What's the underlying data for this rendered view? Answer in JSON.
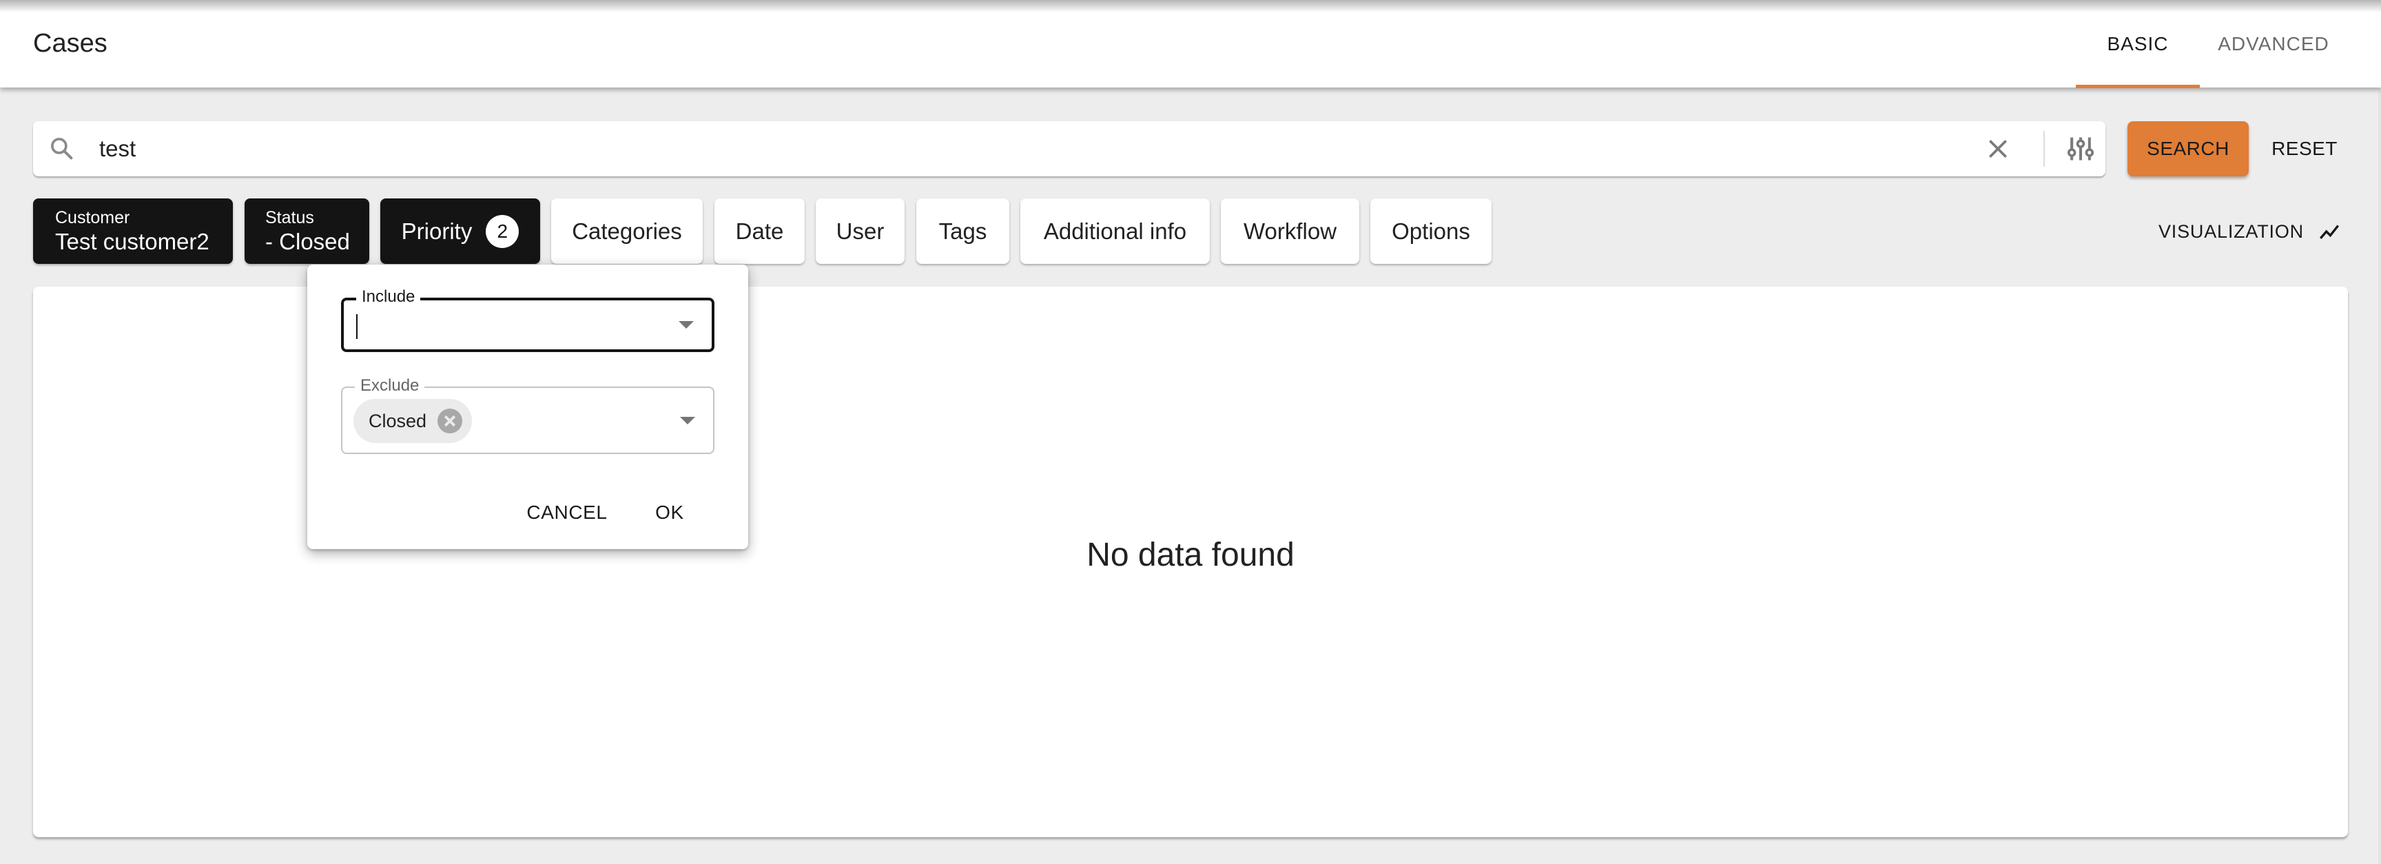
{
  "header": {
    "title": "Cases",
    "tabs": [
      {
        "label": "BASIC",
        "active": true
      },
      {
        "label": "ADVANCED",
        "active": false
      }
    ]
  },
  "search": {
    "value": "test",
    "placeholder": "",
    "icons": {
      "search": "search-icon",
      "clear": "close-icon",
      "filter": "tune-sliders-icon"
    },
    "search_button": "SEARCH",
    "reset_button": "RESET"
  },
  "filters": {
    "customer": {
      "label": "Customer",
      "value": "Test customer2"
    },
    "status": {
      "label": "Status",
      "value": "- Closed"
    },
    "priority": {
      "label": "Priority",
      "count": "2"
    },
    "others": [
      "Categories",
      "Date",
      "User",
      "Tags",
      "Additional info",
      "Workflow",
      "Options"
    ]
  },
  "visualization": {
    "label": "VISUALIZATION",
    "icon": "show-chart-icon"
  },
  "results": {
    "empty_message": "No data found"
  },
  "priority_dialog": {
    "include": {
      "label": "Include",
      "value": "",
      "selected": []
    },
    "exclude": {
      "label": "Exclude",
      "selected": [
        "Closed"
      ]
    },
    "cancel_label": "CANCEL",
    "ok_label": "OK"
  },
  "colors": {
    "accent": "#e07d36",
    "active_chip": "#141414",
    "background": "#ededed"
  }
}
